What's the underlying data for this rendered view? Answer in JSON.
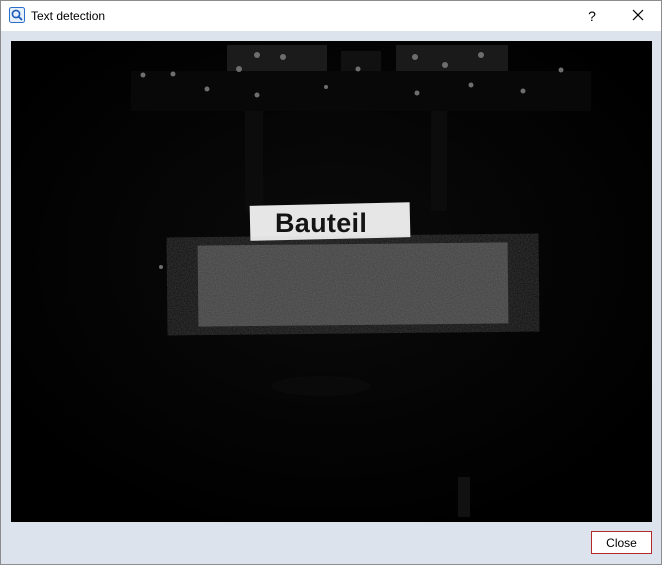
{
  "window": {
    "title": "Text detection",
    "help_label": "?",
    "icon": "search-icon"
  },
  "image": {
    "detected_label": "Bauteil"
  },
  "footer": {
    "close_label": "Close"
  }
}
